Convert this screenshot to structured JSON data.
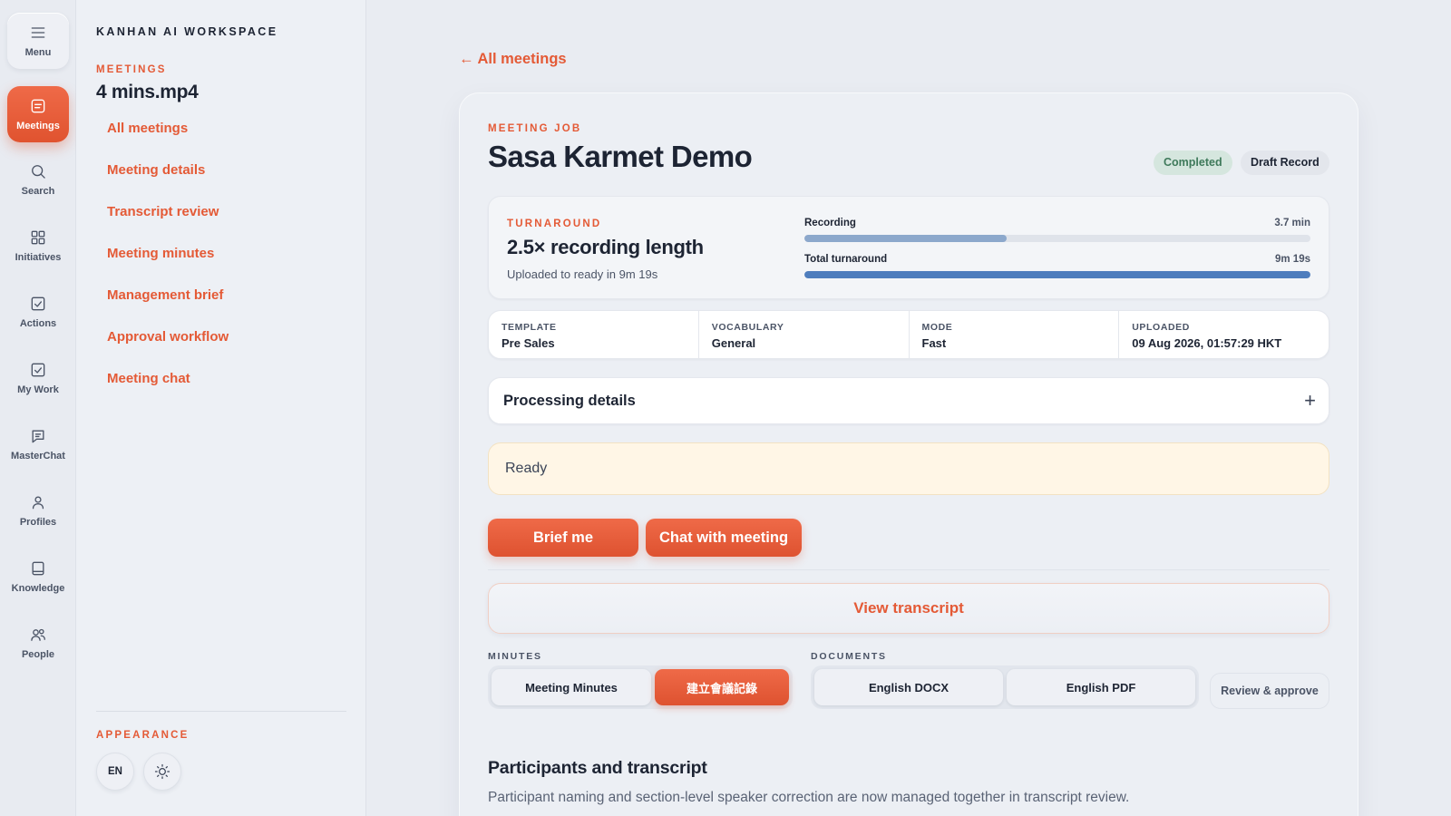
{
  "rail": {
    "items": [
      {
        "label": "Menu",
        "icon": "menu-icon"
      },
      {
        "label": "Meetings",
        "icon": "meetings-icon"
      },
      {
        "label": "Search",
        "icon": "search-icon"
      },
      {
        "label": "Initiatives",
        "icon": "grid-icon"
      },
      {
        "label": "Actions",
        "icon": "checkbox-icon"
      },
      {
        "label": "My Work",
        "icon": "checkbox-icon"
      },
      {
        "label": "MasterChat",
        "icon": "chat-icon"
      },
      {
        "label": "Profiles",
        "icon": "person-icon"
      },
      {
        "label": "Knowledge",
        "icon": "book-icon"
      },
      {
        "label": "People",
        "icon": "people-icon"
      }
    ],
    "active": "Meetings"
  },
  "sidebar": {
    "workspace": "KANHAN AI WORKSPACE",
    "section": "MEETINGS",
    "file_name": "4 mins.mp4",
    "links": [
      "All meetings",
      "Meeting details",
      "Transcript review",
      "Meeting minutes",
      "Management brief",
      "Approval workflow",
      "Meeting chat"
    ],
    "appearance_label": "APPEARANCE",
    "language": "EN",
    "theme_icon": "sun-icon"
  },
  "main": {
    "back_link": "← All meetings",
    "kicker": "MEETING JOB",
    "title": "Sasa Karmet Demo",
    "status_badge": "Completed",
    "record_badge": "Draft Record",
    "turnaround": {
      "kicker": "TURNAROUND",
      "value": "2.5× recording length",
      "sub": "Uploaded to ready in 9m 19s",
      "bars": [
        {
          "label": "Recording",
          "value": "3.7 min",
          "fraction": 0.4
        },
        {
          "label": "Total turnaround",
          "value": "9m 19s",
          "fraction": 1.0
        }
      ]
    },
    "meta": [
      {
        "key": "TEMPLATE",
        "value": "Pre Sales"
      },
      {
        "key": "VOCABULARY",
        "value": "General"
      },
      {
        "key": "MODE",
        "value": "Fast"
      },
      {
        "key": "UPLOADED",
        "value": "09 Aug 2026, 01:57:29 HKT"
      }
    ],
    "processing_title": "Processing details",
    "processing_toggle": "+",
    "status_text": "Ready",
    "brief_button": "Brief me",
    "chat_button": "Chat with meeting",
    "view_transcript": "View transcript",
    "minutes_label": "MINUTES",
    "minutes_buttons": [
      "Meeting Minutes",
      "建立會議記錄"
    ],
    "documents_label": "DOCUMENTS",
    "documents_buttons": [
      "English DOCX",
      "English PDF"
    ],
    "review_button": "Review & approve",
    "participants_title": "Participants and transcript",
    "participants_sub": "Participant naming and section-level speaker correction are now managed together in transcript review."
  },
  "colors": {
    "accent": "#e45a36",
    "success_bg": "#d5e6de",
    "success_text": "#3f7a5b",
    "ready_bg": "#fff6e6",
    "bar_recording": "#8ca8cc",
    "bar_total": "#4e7dbd"
  }
}
